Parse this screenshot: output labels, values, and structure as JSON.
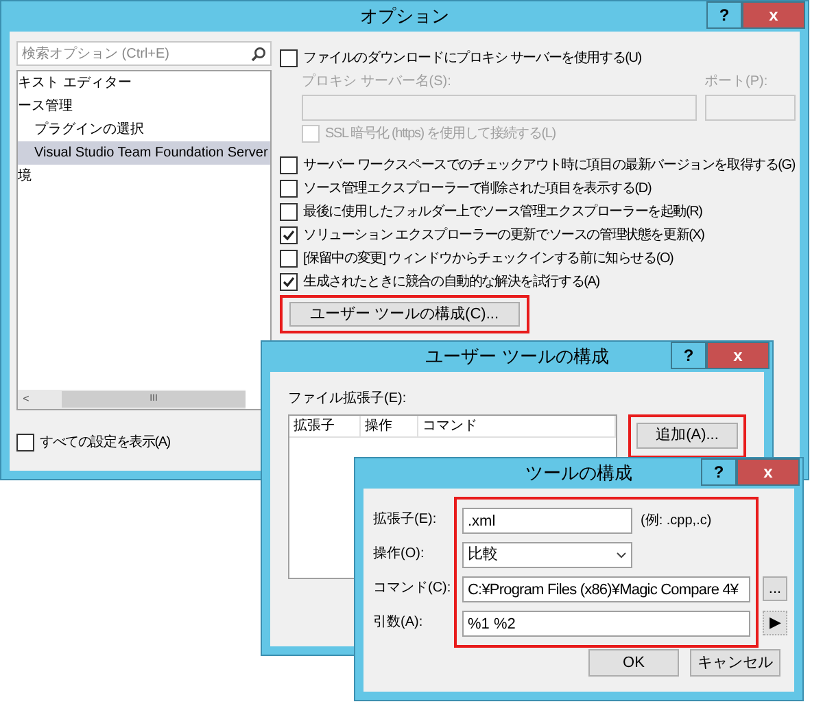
{
  "options_window": {
    "title": "オプション",
    "help": "?",
    "close": "x",
    "search": {
      "placeholder": "検索オプション (Ctrl+E)"
    },
    "tree": [
      {
        "label": "キスト エディター",
        "selected": false
      },
      {
        "label": "ース管理",
        "selected": false,
        "children": [
          {
            "label": "プラグインの選択",
            "selected": false
          },
          {
            "label": "Visual Studio Team Foundation Server",
            "selected": true
          }
        ]
      },
      {
        "label": "境",
        "selected": false
      }
    ],
    "scrollbar_arrow": "<",
    "scrollbar_grip": "III",
    "show_all": {
      "label": "すべての設定を表示(A)",
      "checked": false
    },
    "proxy": {
      "label": "ファイルのダウンロードにプロキシ サーバーを使用する(U)",
      "checked": false,
      "server_label": "プロキシ サーバー名(S):",
      "port_label": "ポート(P):",
      "ssl": {
        "label": "SSL 暗号化 (https) を使用して接続する(L)",
        "checked": false,
        "disabled": true
      }
    },
    "settings": [
      {
        "label": "サーバー ワークスペースでのチェックアウト時に項目の最新バージョンを取得する(G)",
        "checked": false
      },
      {
        "label": "ソース管理エクスプローラーで削除された項目を表示する(D)",
        "checked": false
      },
      {
        "label": "最後に使用したフォルダー上でソース管理エクスプローラーを起動(R)",
        "checked": false
      },
      {
        "label": "ソリューション エクスプローラーの更新でソースの管理状態を更新(X)",
        "checked": true
      },
      {
        "label": "[保留中の変更] ウィンドウからチェックインする前に知らせる(O)",
        "checked": false
      },
      {
        "label": "生成されたときに競合の自動的な解決を試行する(A)",
        "checked": true
      }
    ],
    "configure_button": "ユーザー ツールの構成(C)..."
  },
  "user_tools_window": {
    "title": "ユーザー ツールの構成",
    "help": "?",
    "close": "x",
    "list_label": "ファイル拡張子(E):",
    "columns": [
      "拡張子",
      "操作",
      "コマンド"
    ],
    "add_button": "追加(A)..."
  },
  "tool_window": {
    "title": "ツールの構成",
    "help": "?",
    "close": "x",
    "extension": {
      "label": "拡張子(E):",
      "value": ".xml",
      "hint": "(例: .cpp,.c)"
    },
    "operation": {
      "label": "操作(O):",
      "value": "比較"
    },
    "command": {
      "label": "コマンド(C):",
      "value": "C:¥Program Files (x86)¥Magic Compare 4¥",
      "browse": "..."
    },
    "arguments": {
      "label": "引数(A):",
      "value": "%1 %2",
      "menu": "▶"
    },
    "ok": "OK",
    "cancel": "キャンセル"
  }
}
